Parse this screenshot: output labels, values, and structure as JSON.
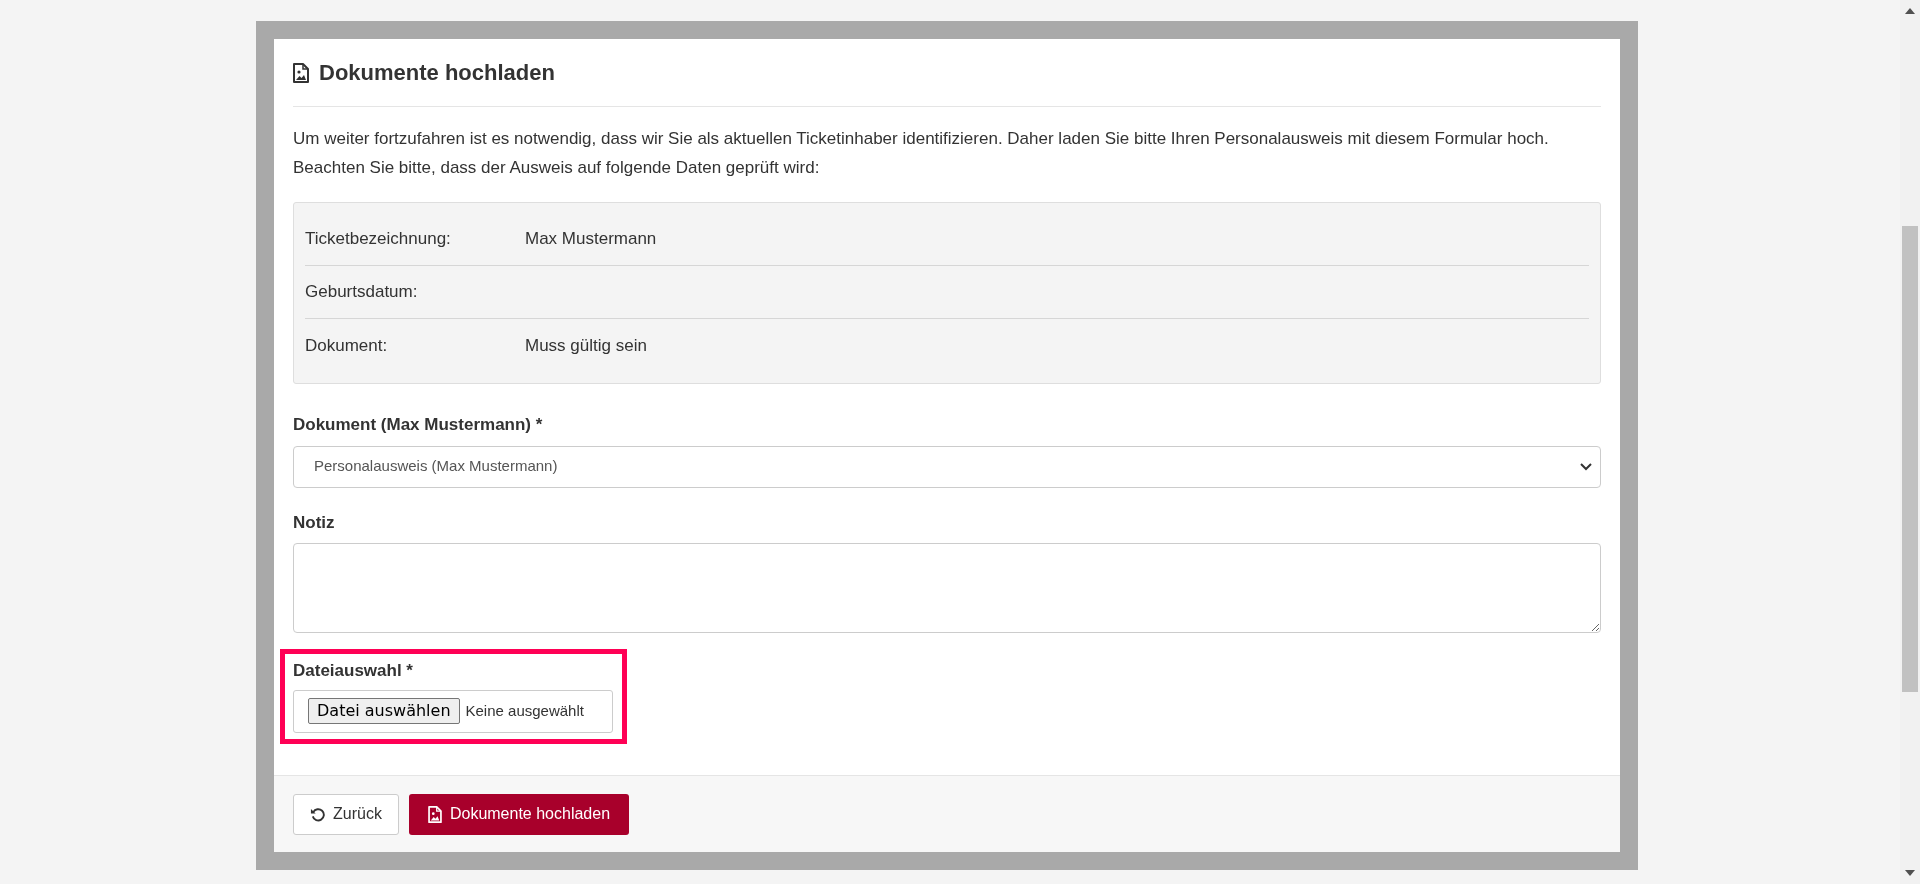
{
  "card": {
    "title": "Dokumente hochladen",
    "intro": "Um weiter fortzufahren ist es notwendig, dass wir Sie als aktuellen Ticketinhaber identifizieren. Daher laden Sie bitte Ihren Personalausweis mit diesem Formular hoch. Beachten Sie bitte, dass der Ausweis auf folgende Daten geprüft wird:",
    "checks": [
      {
        "label": "Ticketbezeichnung:",
        "value": "Max Mustermann"
      },
      {
        "label": "Geburtsdatum:"
      },
      {
        "label": "Dokument:",
        "value": "Muss gültig sein"
      }
    ],
    "document_select": {
      "label": "Dokument (Max Mustermann) *",
      "value": "Personalausweis (Max Mustermann)"
    },
    "note": {
      "label": "Notiz"
    },
    "file_input": {
      "label": "Dateiauswahl *",
      "button": "Datei auswählen",
      "status": "Keine ausgewählt",
      "highlighted": true
    },
    "buttons": [
      {
        "kind": "secondary",
        "label": "Zurück"
      },
      {
        "kind": "primary",
        "label": "Dokumente hochladen"
      }
    ]
  }
}
